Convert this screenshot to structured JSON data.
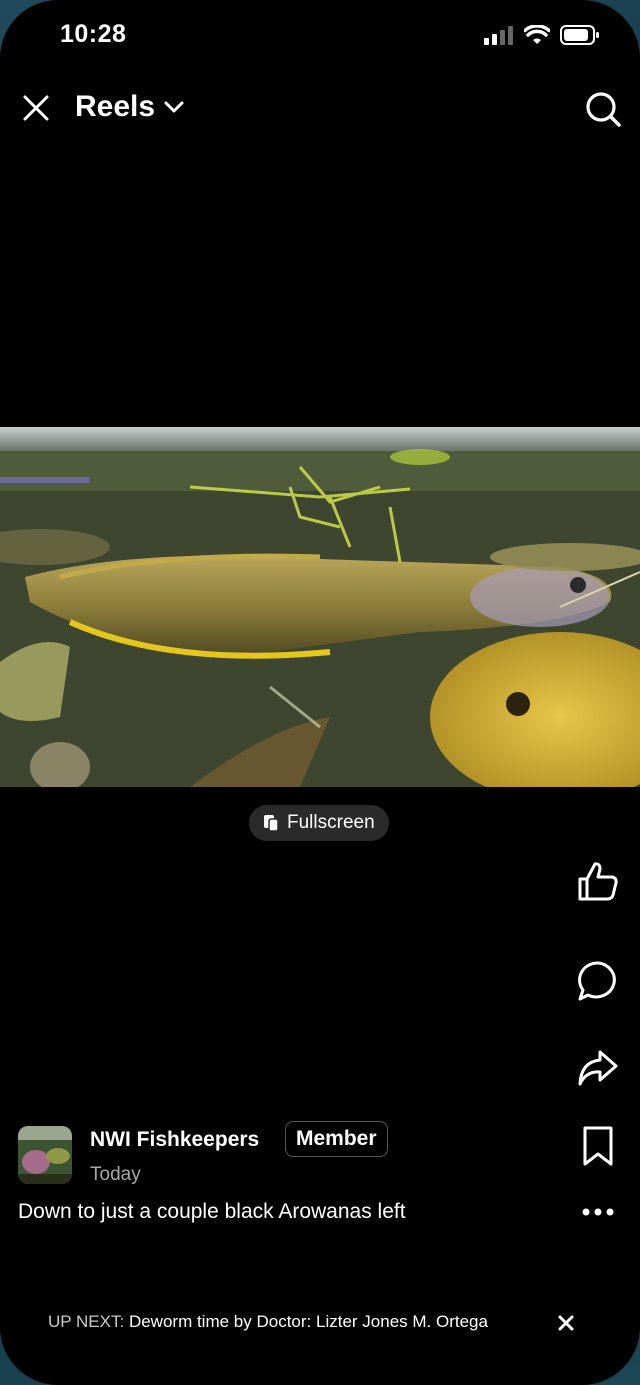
{
  "status_bar": {
    "time": "10:28"
  },
  "header": {
    "title": "Reels"
  },
  "video": {
    "fullscreen_label": "Fullscreen"
  },
  "post": {
    "author": "NWI Fishkeepers",
    "badge": "Member",
    "time": "Today",
    "caption": "Down to just a couple black Arowanas left"
  },
  "up_next": {
    "label": "UP NEXT:",
    "title": "Deworm time by Doctor: Lizter Jones M. Ortega"
  },
  "icons": {
    "close": "close-icon",
    "dropdown": "chevron-down-icon",
    "search": "search-icon",
    "fullscreen": "fullscreen-icon",
    "like": "thumbs-up-icon",
    "comment": "comment-icon",
    "share": "share-icon",
    "save": "bookmark-icon",
    "more": "more-icon"
  }
}
